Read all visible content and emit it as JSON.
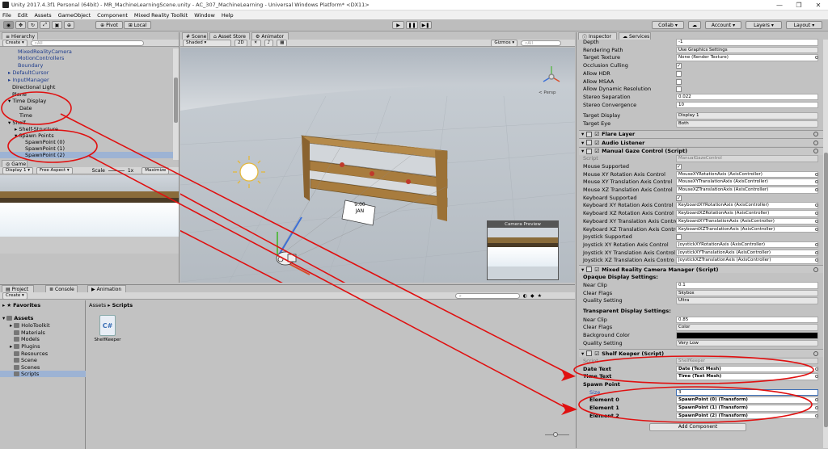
{
  "window": {
    "title": "Unity 2017.4.3f1 Personal (64bit) - MR_MachineLearningScene.unity - AC_307_MachineLearning - Universal Windows Platform* <DX11>",
    "buttons": [
      "—",
      "❐",
      "✕"
    ]
  },
  "menu": [
    "File",
    "Edit",
    "Assets",
    "GameObject",
    "Component",
    "Mixed Reality Toolkit",
    "Window",
    "Help"
  ],
  "toolbar": {
    "pivot": "Pivot",
    "local": "Local",
    "collab": "Collab",
    "account": "Account",
    "layers": "Layers",
    "layout": "Layout"
  },
  "hierarchy": {
    "tab": "Hierarchy",
    "create": "Create",
    "search": "All",
    "items": [
      "MixedRealityCamera",
      "MotionControllers",
      "Boundary",
      "DefaultCursor",
      "InputManager",
      "Directional Light",
      "Plane",
      "Time Display",
      "Date",
      "Time",
      "Shelf",
      "Shelf-Structure",
      "Spawn Points",
      "SpawnPoint (0)",
      "SpawnPoint (1)",
      "SpawnPoint (2)"
    ]
  },
  "game": {
    "tab": "Game",
    "display": "Display 1",
    "aspect": "Free Aspect",
    "scale_label": "Scale",
    "scale_value": "1x",
    "maximize": "Maximize"
  },
  "scene": {
    "tabs": [
      "Scene",
      "Asset Store",
      "Animator"
    ],
    "shading": "Shaded",
    "mode": "2D",
    "gizmos": "Gizmos",
    "search": "All",
    "label_time": "9:00",
    "label_date": "JAN",
    "camera_preview": "Camera Preview",
    "persp": "< Persp"
  },
  "project": {
    "tabs": [
      "Project",
      "Console",
      "Animation"
    ],
    "create": "Create",
    "favorites": "Favorites",
    "assets": "Assets",
    "folders": [
      "HoloToolkit",
      "Materials",
      "Models",
      "Plugins",
      "Resources",
      "Scene",
      "Scenes",
      "Scripts"
    ],
    "breadcrumb": [
      "Assets",
      "Scripts"
    ],
    "file": "ShelfKeeper",
    "file_glyph": "C#"
  },
  "inspector": {
    "tabs": [
      "Inspector",
      "Services"
    ],
    "camera": [
      {
        "label": "Depth",
        "value": "-1"
      },
      {
        "label": "Rendering Path",
        "value": "Use Graphics Settings",
        "dd": true
      },
      {
        "label": "Target Texture",
        "value": "None (Render Texture)"
      },
      {
        "label": "Occlusion Culling",
        "check": "✓"
      },
      {
        "label": "Allow HDR",
        "check": ""
      },
      {
        "label": "Allow MSAA",
        "check": ""
      },
      {
        "label": "Allow Dynamic Resolution",
        "check": ""
      },
      {
        "label": "Stereo Separation",
        "value": "0.022"
      },
      {
        "label": "Stereo Convergence",
        "value": "10"
      },
      {
        "label": "Target Display",
        "value": "Display 1",
        "dd": true
      },
      {
        "label": "Target Eye",
        "value": "Both",
        "dd": true
      }
    ],
    "flare": "Flare Layer",
    "audio": "Audio Listener",
    "gaze_title": "Manual Gaze Control (Script)",
    "gaze": [
      {
        "label": "Script",
        "value": "ManualGazeControl",
        "grey": true
      },
      {
        "label": "Mouse Supported",
        "check": "✓"
      },
      {
        "label": "Mouse XY Rotation Axis Control",
        "value": "MouseXYRotationAxis (AxisController)"
      },
      {
        "label": "Mouse XY Translation Axis Control",
        "value": "MouseXYTranslationAxis (AxisController)"
      },
      {
        "label": "Mouse XZ Translation Axis Control",
        "value": "MouseXZTranslationAxis (AxisController)"
      },
      {
        "label": "Keyboard Supported",
        "check": "✓"
      },
      {
        "label": "Keyboard XY Rotation Axis Control",
        "value": "KeyboardXYRotationAxis (AxisController)"
      },
      {
        "label": "Keyboard XZ Rotation Axis Control",
        "value": "KeyboardXZRotationAxis (AxisController)"
      },
      {
        "label": "Keyboard XY Translation Axis Contro",
        "value": "KeyboardXYTranslationAxis (AxisController)"
      },
      {
        "label": "Keyboard XZ Translation Axis Contro",
        "value": "KeyboardXZTranslationAxis (AxisController)"
      },
      {
        "label": "Joystick Supported",
        "check": ""
      },
      {
        "label": "Joystick XY Rotation Axis Control",
        "value": "JoystickXYRotationAxis (AxisController)"
      },
      {
        "label": "Joystick XY Translation Axis Control",
        "value": "JoystickXYTranslationAxis (AxisController)"
      },
      {
        "label": "Joystick XZ Translation Axis Contro",
        "value": "JoystickXZTranslationAxis (AxisController)"
      }
    ],
    "mrcm_title": "Mixed Reality Camera Manager (Script)",
    "opaque_head": "Opaque Display Settings:",
    "opaque": [
      {
        "label": "Near Clip",
        "value": "0.1"
      },
      {
        "label": "Clear Flags",
        "value": "Skybox",
        "dd": true
      },
      {
        "label": "Quality Setting",
        "value": "Ultra",
        "dd": true
      }
    ],
    "trans_head": "Transparent Display Settings:",
    "trans": [
      {
        "label": "Near Clip",
        "value": "0.85"
      },
      {
        "label": "Clear Flags",
        "value": "Color",
        "dd": true
      },
      {
        "label": "Background Color",
        "value": "",
        "color": "#000000"
      },
      {
        "label": "Quality Setting",
        "value": "Very Low",
        "dd": true
      }
    ],
    "keeper_title": "Shelf Keeper (Script)",
    "keeper": [
      {
        "label": "Script",
        "value": "ShelfKeeper",
        "grey": true
      },
      {
        "label": "Date Text",
        "value": "Date (Text Mesh)",
        "bold": true
      },
      {
        "label": "Time Text",
        "value": "Time (Text Mesh)",
        "bold": true
      },
      {
        "label": "Spawn Point",
        "value": "",
        "bold": true,
        "nofield": true
      },
      {
        "label": "Size",
        "value": "3",
        "blue": true,
        "indent": true
      },
      {
        "label": "Element 0",
        "value": "SpawnPoint (0) (Transform)",
        "bold": true,
        "indent": true
      },
      {
        "label": "Element 1",
        "value": "SpawnPoint (1) (Transform)",
        "bold": true,
        "indent": true
      },
      {
        "label": "Element 2",
        "value": "SpawnPoint (2) (Transform)",
        "bold": true,
        "indent": true
      }
    ],
    "add_component": "Add Component"
  },
  "colors": {
    "annotation": "#e01010",
    "selection": "#3d6fb6"
  }
}
